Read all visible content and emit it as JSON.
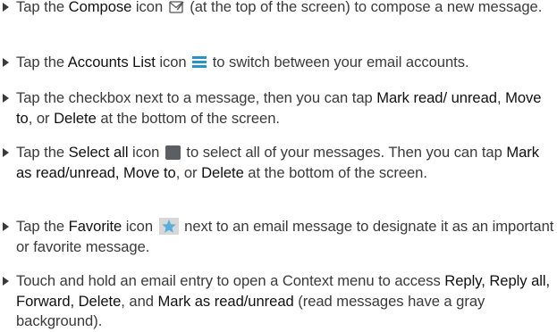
{
  "instructions": {
    "item1": {
      "p1": "Tap the ",
      "b1": "Compose",
      "p2": " icon",
      "p3": " (at the top of the screen) to compose a new message."
    },
    "item2": {
      "p1": "Tap the ",
      "b1": "Accounts List",
      "p2": " icon",
      "p3": " to switch between your email accounts."
    },
    "item3": {
      "p1": "Tap the checkbox next to a message, then you can tap ",
      "b1": "Mark read/ unread",
      "p2": ", ",
      "b2": "Move to",
      "p3": ", or ",
      "b3": "Delete",
      "p4": " at the bottom of the screen."
    },
    "item4": {
      "p1": "Tap the ",
      "b1": "Select all",
      "p2": " icon",
      "p3": " to select all of your messages. Then you can tap ",
      "b2": "Mark as read/unread, Move to",
      "p4": ", or ",
      "b3": "Delete",
      "p5": " at the bottom of the screen."
    },
    "item5": {
      "p1": "Tap the ",
      "b1": "Favorite",
      "p2": " icon",
      "p3": " next to an email message to designate it as an important or favorite message."
    },
    "item6": {
      "p1": "Touch and hold an email entry to open a Context menu to access ",
      "b1": "Reply, Reply all, Forward, Delete",
      "p2": ", and ",
      "b2": "Mark as read/unread",
      "p3": " (read messages have a gray background)."
    }
  },
  "icons": {
    "compose": "compose-icon",
    "accounts_list": "accounts-list-icon",
    "select_all": "select-all-icon",
    "favorite": "favorite-star-icon"
  },
  "colors": {
    "text": "#3a3a3a",
    "emphasis": "#111111",
    "accounts_list_icon": "#2a92c9",
    "select_all_icon": "#5a5f63",
    "favorite_icon_bg": "#d8d8d8",
    "favorite_star": "#5aaedc"
  }
}
